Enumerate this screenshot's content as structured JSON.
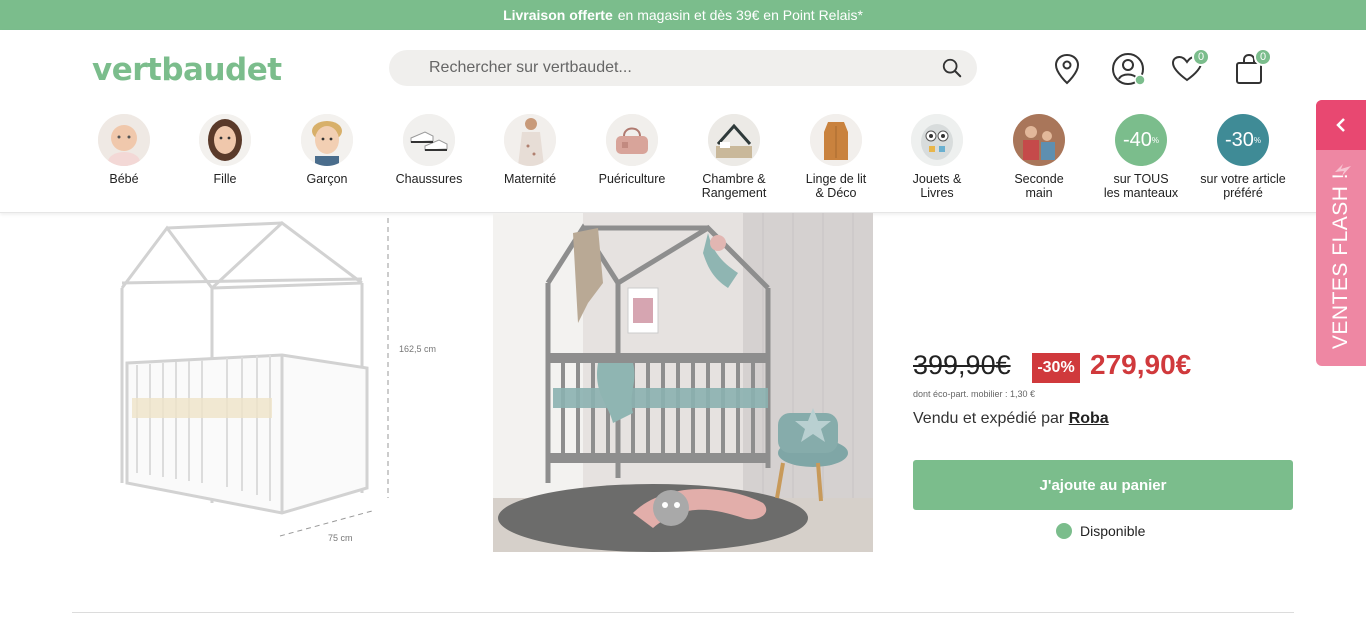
{
  "banner": {
    "bold": "Livraison offerte",
    "rest": "en magasin et dès 39€ en Point Relais*"
  },
  "header": {
    "logo": "vertbaudet",
    "search_placeholder": "Rechercher sur vertbaudet...",
    "wishlist_count": "0",
    "cart_count": "0"
  },
  "categories": [
    {
      "label": "Bébé",
      "icon": "baby-photo"
    },
    {
      "label": "Fille",
      "icon": "girl-photo"
    },
    {
      "label": "Garçon",
      "icon": "boy-photo"
    },
    {
      "label": "Chaussures",
      "icon": "shoes-photo"
    },
    {
      "label": "Maternité",
      "icon": "maternity-photo"
    },
    {
      "label": "Puériculture",
      "icon": "nursery-bag-photo"
    },
    {
      "label": "Chambre &\nRangement",
      "icon": "bedroom-photo"
    },
    {
      "label": "Linge de lit\n& Déco",
      "icon": "sleeping-bag-photo"
    },
    {
      "label": "Jouets &\nLivres",
      "icon": "toy-photo"
    },
    {
      "label": "Seconde\nmain",
      "icon": "second-hand-photo"
    },
    {
      "label": "sur TOUS\nles manteaux",
      "promo": "-40",
      "color": "#7bbd8c"
    },
    {
      "label": "sur votre article\npréféré",
      "promo": "-30",
      "color": "#3f8b96"
    }
  ],
  "product": {
    "dimension_height": "162,5 cm",
    "dimension_width": "75 cm",
    "old_price": "399,90€",
    "discount": "-30%",
    "new_price": "279,90€",
    "eco_part": "dont éco-part. mobilier : 1,30 €",
    "seller_prefix": "Vendu et expédié par",
    "seller_name": "Roba",
    "cart_button": "J'ajoute au panier",
    "availability": "Disponible"
  },
  "flash_tab": {
    "label": "VENTES FLASH !"
  },
  "colors": {
    "brand_green": "#7bbd8c",
    "price_red": "#d0393c",
    "flash_pink": "#ee87a3",
    "teal": "#3f8b96"
  }
}
